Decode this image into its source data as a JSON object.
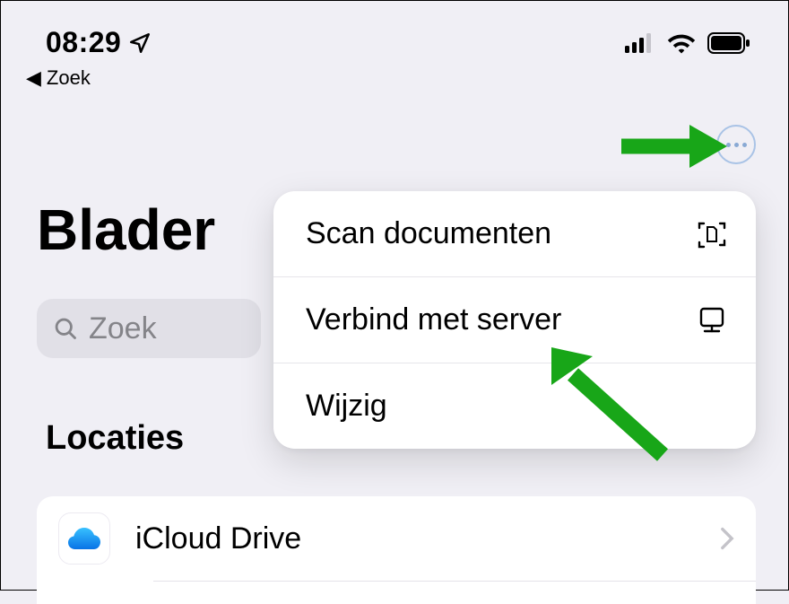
{
  "statusbar": {
    "time": "08:29"
  },
  "back": {
    "label": "Zoek"
  },
  "page": {
    "title": "Blader",
    "search_placeholder": "Zoek",
    "section_header": "Locaties"
  },
  "popup": {
    "scan_label": "Scan documenten",
    "server_label": "Verbind met server",
    "edit_label": "Wijzig"
  },
  "locations": {
    "icloud_label": "iCloud Drive"
  }
}
